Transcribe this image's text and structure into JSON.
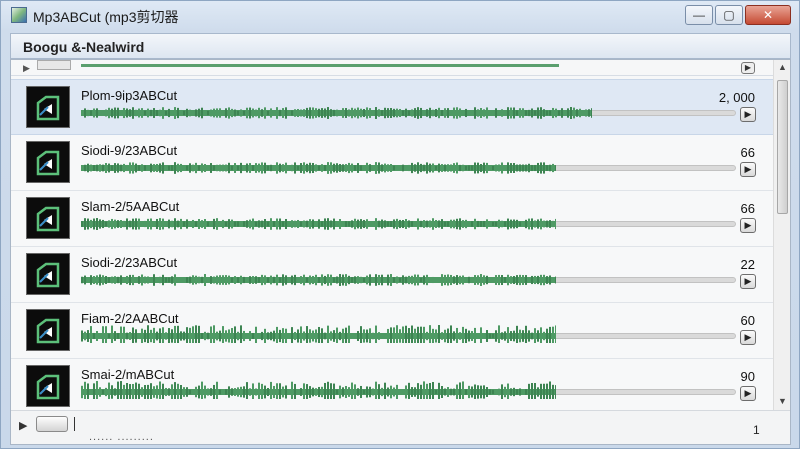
{
  "window": {
    "title": "Mp3ABCut (mp3剪切器",
    "controls": {
      "minimize": "—",
      "maximize": "▢",
      "close": "✕"
    }
  },
  "header": {
    "title": "Boogu &-Nealwird"
  },
  "tracks": [
    {
      "title": "Plom-9ip3ABCut",
      "value": "2, 000",
      "selected": true,
      "fill": 0.78
    },
    {
      "title": "Siodi-9/23ABCut",
      "value": "66",
      "selected": false,
      "fill": 0.725
    },
    {
      "title": "Slam-2/5AABCut",
      "value": "66",
      "selected": false,
      "fill": 0.725
    },
    {
      "title": "Siodi-2/23ABCut",
      "value": "22",
      "selected": false,
      "fill": 0.725
    },
    {
      "title": "Fiam-2/2AABCut",
      "value": "60",
      "selected": false,
      "fill": 0.725
    },
    {
      "title": "Smai-2/mABCut",
      "value": "90",
      "selected": false,
      "fill": 0.725
    }
  ],
  "footer": {
    "dots": "......  .........",
    "page": "1"
  },
  "colors": {
    "wave": "#4e9a64",
    "wave_dark": "#3d8452",
    "selected_row": "#dfe8f4"
  },
  "icons": {
    "play": "▶",
    "scroll_up": "▲",
    "scroll_down": "▼",
    "scroll_left": "▶"
  }
}
